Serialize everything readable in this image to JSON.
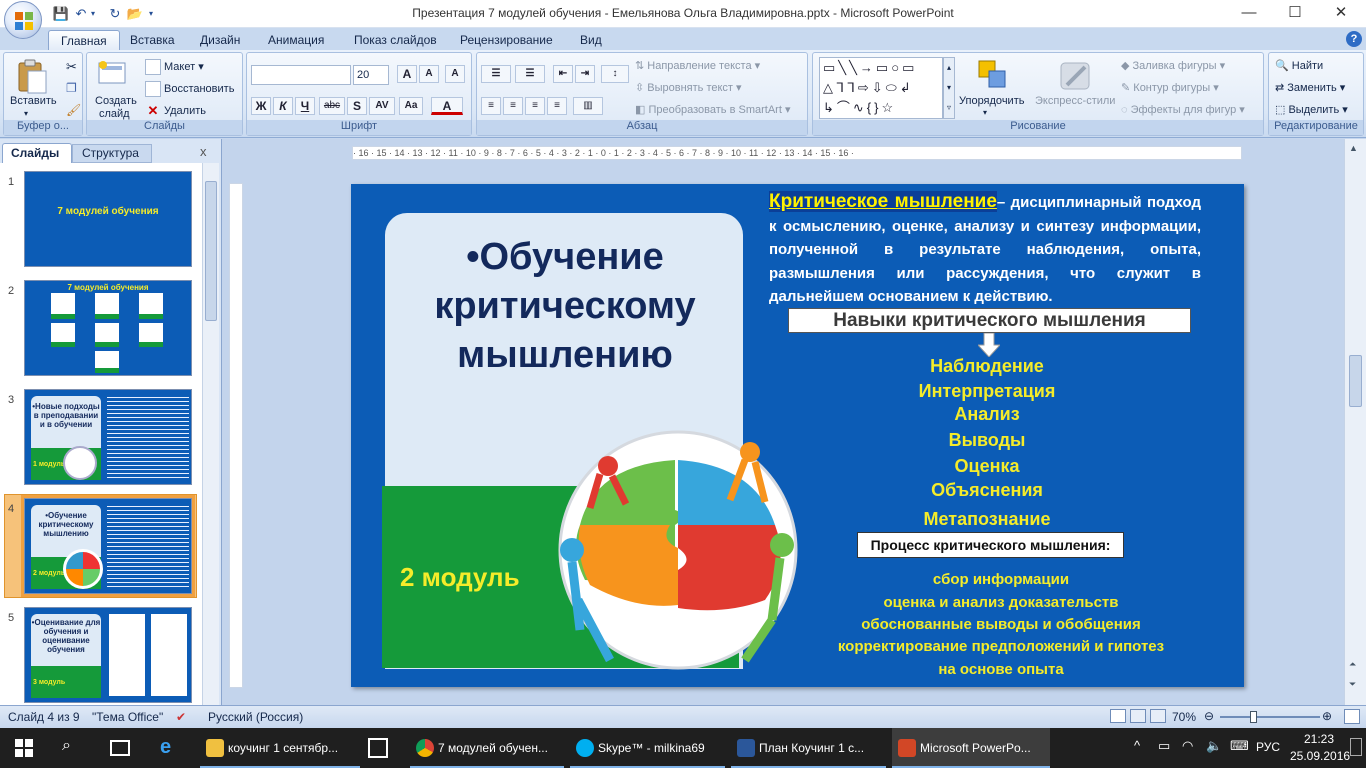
{
  "window": {
    "title": "Презентация 7 модулей обучения - Емельянова Ольга Владимировна.pptx - Microsoft PowerPoint",
    "min": "—",
    "max": "☐",
    "close": "✕"
  },
  "tabs": [
    "Главная",
    "Вставка",
    "Дизайн",
    "Анимация",
    "Показ слайдов",
    "Рецензирование",
    "Вид"
  ],
  "ribbon": {
    "clipboard": {
      "label": "Буфер о...",
      "paste": "Вставить"
    },
    "slides": {
      "label": "Слайды",
      "create": "Создать",
      "slide": "слайд",
      "layout": "Макет",
      "reset": "Восстановить",
      "delete": "Удалить"
    },
    "font": {
      "label": "Шрифт",
      "size": "20",
      "bold": "Ж",
      "italic": "К",
      "underline": "Ч",
      "strike": "abc",
      "shadow": "S",
      "spacing": "AV",
      "case": "Aa"
    },
    "paragraph": {
      "label": "Абзац",
      "direction": "Направление текста",
      "align": "Выровнять текст",
      "smartart": "Преобразовать в SmartArt"
    },
    "drawing": {
      "label": "Рисование",
      "arrange": "Упорядочить",
      "quickstyles": "Экспресс-стили",
      "fill": "Заливка фигуры",
      "outline": "Контур фигуры",
      "effects": "Эффекты для фигур"
    },
    "editing": {
      "label": "Редактирование",
      "find": "Найти",
      "replace": "Заменить",
      "select": "Выделить"
    }
  },
  "panel": {
    "tab_slides": "Слайды",
    "tab_outline": "Структура",
    "close": "x"
  },
  "thumbs": [
    {
      "num": "1",
      "title": "7 модулей обучения"
    },
    {
      "num": "2",
      "title": "7 модулей обучения"
    },
    {
      "num": "3",
      "title": "•Новые подходы в преподавании и в обучении",
      "module": "1 модуль"
    },
    {
      "num": "4",
      "title": "•Обучение критическому мышлению",
      "module": "2 модуль"
    },
    {
      "num": "5",
      "title": "•Оценивание для обучения и оценивание обучения",
      "module": "3 модуль"
    }
  ],
  "ruler": {
    "h": "· 16 · 15 · 14 · 13 · 12 · 11 · 10 · 9 · 8 · 7 · 6 · 5 · 4 · 3 · 2 · 1 · 0 · 1 · 2 · 3 · 4 · 5 · 6 · 7 · 8 · 9 · 10 · 11 · 12 · 13 · 14 · 15 · 16 ·"
  },
  "slide": {
    "title_line1": "•Обучение",
    "title_line2": "критическому",
    "title_line3": "мышлению",
    "module": "2 модуль",
    "crit_term": "Критическое мышление",
    "crit_def": "– дисциплинарный подход к осмыслению, оценке, анализу и синтезу информации, полученной в результате наблюдения, опыта, размышления или рассуждения, что служит в дальнейшем основанием к действию.",
    "skills_title": "Навыки критического мышления",
    "skills": [
      "Наблюдение",
      "Интерпретация",
      "Анализ",
      "Выводы",
      "Оценка",
      "Объяснения",
      "Метапознание"
    ],
    "process_title": "Процесс критического мышления:",
    "process": [
      "сбор информации",
      "оценка и анализ доказательств",
      "обоснованные выводы и обобщения",
      "корректирование предположений и гипотез",
      "на основе опыта"
    ]
  },
  "status": {
    "slide": "Слайд 4 из 9",
    "theme": "\"Тема Office\"",
    "lang": "Русский (Россия)",
    "zoom": "70%"
  },
  "taskbar": {
    "items": [
      "коучинг 1 сентябр...",
      "7 модулей обучен...",
      "Skype™ - milkina69",
      "План Коучинг  1 с...",
      "Microsoft PowerPo..."
    ],
    "lang": "РУС",
    "time": "21:23",
    "date": "25.09.2016"
  },
  "colors": {
    "slide_bg": "#0c5cb6",
    "accent_yellow": "#f5ec2a",
    "module_green": "#159a3a"
  }
}
